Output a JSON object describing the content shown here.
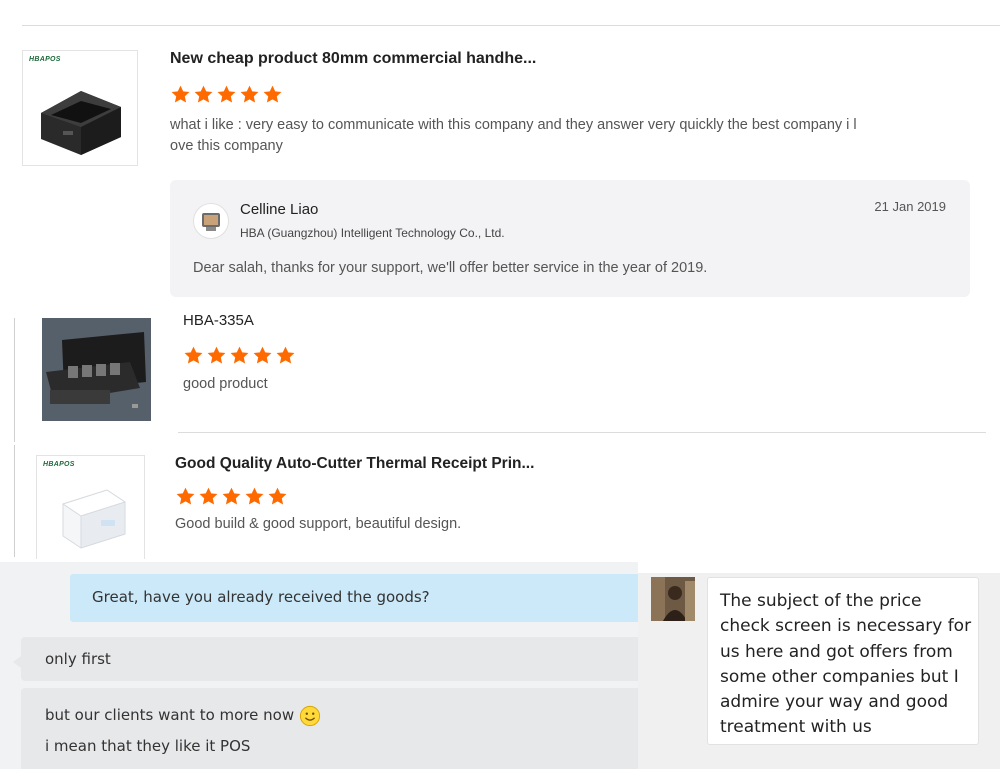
{
  "reviews": [
    {
      "brand": "HBAPOS",
      "title": "New cheap product 80mm commercial handhe...",
      "rating": 5,
      "text_line1": "what i like : very easy to communicate with this company and they answer very quickly the best company i l",
      "text_line2": "ove this company",
      "reply": {
        "name": "Celline Liao",
        "company": "HBA (Guangzhou) Intelligent Technology Co., Ltd.",
        "date": "21 Jan 2019",
        "message": "Dear salah, thanks for your support, we'll offer better service in the year of 2019."
      }
    },
    {
      "title": "HBA-335A",
      "rating": 5,
      "text": "good product"
    },
    {
      "brand": "HBAPOS",
      "title": "Good Quality Auto-Cutter Thermal Receipt Prin...",
      "rating": 5,
      "text": "Good build & good support, beautiful design."
    }
  ],
  "chat": {
    "question": "Great, have you already received the goods?",
    "reply1": "only first",
    "reply2_line1": "but our clients want to more now",
    "reply2_line2": "i mean that they like it POS",
    "long_message": [
      "The subject of the price",
      "check screen is necessary for",
      "us here and got offers from",
      "some other companies but I",
      "admire your way and good",
      "treatment with us"
    ]
  },
  "colors": {
    "star": "#ff6a00",
    "chat_blue": "#cbe9f8",
    "reply_bg": "#f3f3f5"
  },
  "icons": [
    "star-icon",
    "avatar-icon",
    "smile-emoji-icon"
  ]
}
